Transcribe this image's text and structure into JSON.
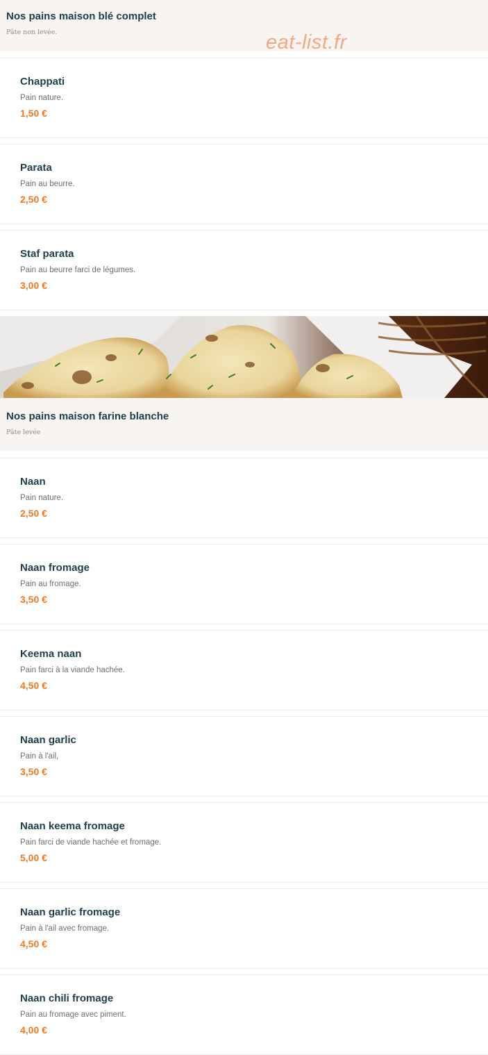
{
  "watermark": "eat-list.fr",
  "sections": [
    {
      "title": "Nos pains maison blé complet",
      "subtitle": "Pâte non levée.",
      "items": [
        {
          "name": "Chappati",
          "desc": "Pain nature.",
          "price": "1,50 €"
        },
        {
          "name": "Parata",
          "desc": "Pain au beurre.",
          "price": "2,50 €"
        },
        {
          "name": "Staf parata",
          "desc": "Pain au beurre farci de légumes.",
          "price": "3,00 €"
        }
      ]
    },
    {
      "title": "Nos pains maison farine blanche",
      "subtitle": "Pâte levée",
      "items": [
        {
          "name": "Naan",
          "desc": "Pain nature.",
          "price": "2,50 €"
        },
        {
          "name": "Naan fromage",
          "desc": "Pain au fromage.",
          "price": "3,50 €"
        },
        {
          "name": "Keema naan",
          "desc": "Pain farci à la viande hachée.",
          "price": "4,50 €"
        },
        {
          "name": "Naan garlic",
          "desc": "Pain à l'ail,",
          "price": "3,50 €"
        },
        {
          "name": "Naan keema fromage",
          "desc": "Pain farci de viande hachée et fromage.",
          "price": "5,00 €"
        },
        {
          "name": "Naan garlic fromage",
          "desc": "Pain à l'ail avec fromage.",
          "price": "4,50 €"
        },
        {
          "name": "Naan chili fromage",
          "desc": "Pain au fromage avec piment.",
          "price": "4,00 €"
        }
      ]
    }
  ],
  "colors": {
    "title": "#1d3f4a",
    "price": "#ef7a22",
    "header_bg": "#f8f4f1",
    "watermark": "#f3a882"
  }
}
